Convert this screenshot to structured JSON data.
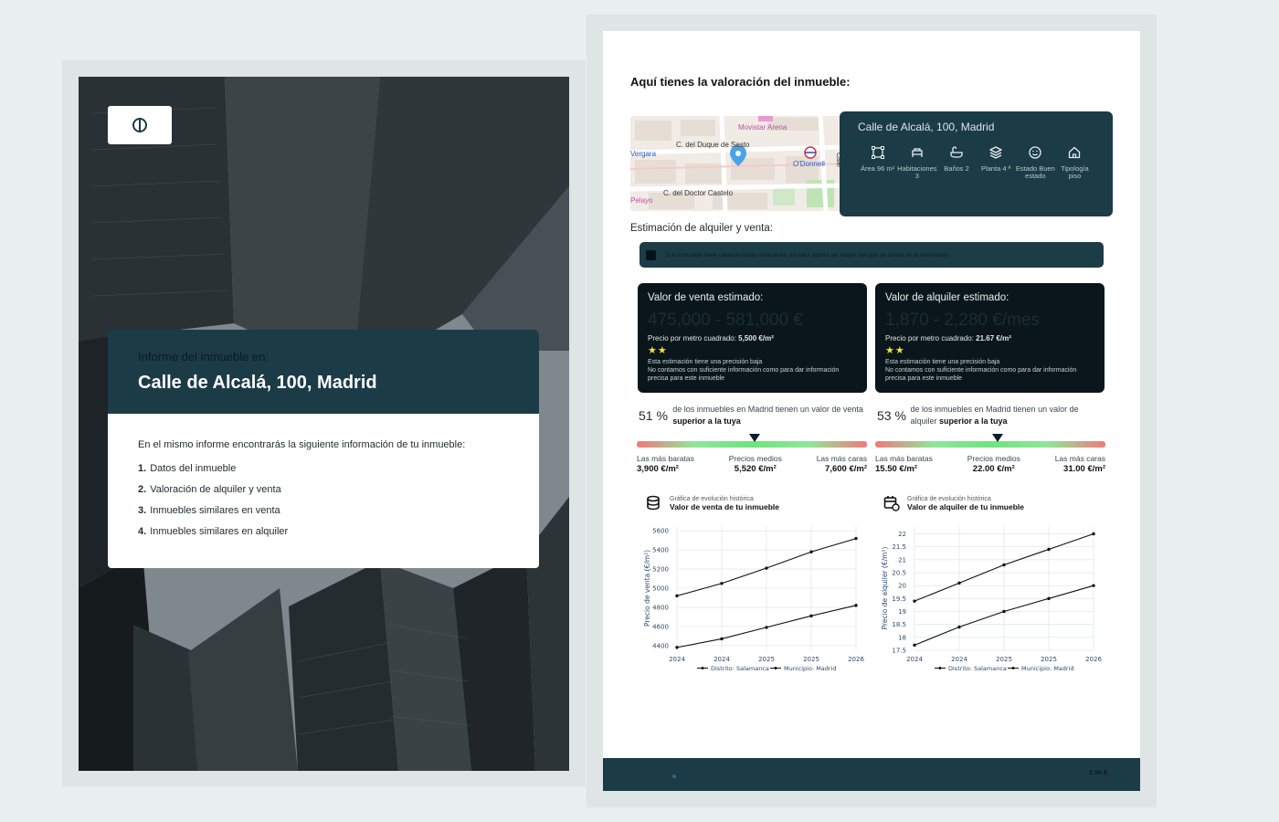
{
  "cover": {
    "subtitle": "Informe del inmueble en:",
    "address": "Calle de Alcalá, 100, Madrid",
    "intro": "En el mismo informe encontrarás la siguiente información de tu inmueble:",
    "items": [
      {
        "num": "1.",
        "label": "Datos del inmueble"
      },
      {
        "num": "2.",
        "label": "Valoración de alquiler y venta"
      },
      {
        "num": "3.",
        "label": "Inmuebles similares en venta"
      },
      {
        "num": "4.",
        "label": "Inmuebles similares en alquiler"
      }
    ]
  },
  "page2": {
    "title": "Aquí tienes la valoración del inmueble:",
    "map_labels": [
      "Movistar Arena",
      "C. del Duque de Sesto",
      "Vergara",
      "O'Donnell",
      "C. del Doctor Castelo",
      "Pelayo",
      "Calle"
    ],
    "property": {
      "address": "Calle de Alcalá, 100, Madrid",
      "features": [
        {
          "icon": "area-icon",
          "label": "Área 96 m²"
        },
        {
          "icon": "bed-icon",
          "label": "Habitaciones 3"
        },
        {
          "icon": "bath-icon",
          "label": "Baños 2"
        },
        {
          "icon": "layers-icon",
          "label": "Planta 4 ª"
        },
        {
          "icon": "smile-icon",
          "label": "Estado Buen estado"
        },
        {
          "icon": "home-icon",
          "label": "Tipología piso"
        }
      ]
    },
    "estimation_title": "Estimación de alquiler y venta:",
    "banner": "Si tu inmueble tiene características exclusivas, su valor podría ser mayor del que se ofrece en la estimación.",
    "sale": {
      "heading": "Valor de venta estimado:",
      "range": "475,000 - 581,000 €",
      "ppm_label": "Precio por metro cuadrado:",
      "ppm_value": "5,500 €/m²",
      "stars": "★★",
      "stars_count": 2,
      "note1": "Esta estimación tiene una precisión baja",
      "note2": "No contamos con suficiente información como para dar información precisa para este inmueble",
      "pct": "51 %",
      "pct_value": 51,
      "desc_pre": "de los inmuebles en Madrid tienen un valor de venta ",
      "desc_bold": "superior a la tuya",
      "low_label": "Las más baratas",
      "low_value": "3,900 €/m²",
      "mid_label": "Precios medios",
      "mid_value": "5,520 €/m²",
      "high_label": "Las más caras",
      "high_value": "7,600 €/m²",
      "chart_kicker": "Gráfica de evolución histórica",
      "chart_title": "Valor de venta de tu inmueble"
    },
    "rent": {
      "heading": "Valor de alquiler estimado:",
      "range": "1,870 - 2,280 €/mes",
      "ppm_label": "Precio por metro cuadrado:",
      "ppm_value": "21.67 €/m²",
      "stars": "★★",
      "stars_count": 2,
      "note1": "Esta estimación tiene una precisión baja",
      "note2": "No contamos con suficiente información como para dar información precisa para este inmueble",
      "pct": "53 %",
      "pct_value": 53,
      "desc_pre": "de los inmuebles en Madrid tienen un valor de alquiler ",
      "desc_bold": "superior a la tuya",
      "low_label": "Las más baratas",
      "low_value": "15.50 €/m²",
      "mid_label": "Precios medios",
      "mid_value": "22.00 €/m²",
      "high_label": "Las más caras",
      "high_value": "31.00 €/m²",
      "chart_kicker": "Gráfica de evolución histórica",
      "chart_title": "Valor de alquiler de tu inmueble"
    },
    "footer_page": "2 de 6"
  },
  "chart_data": [
    {
      "type": "line",
      "title": "",
      "ylabel": "Precio de venta (€/m²)",
      "xlabel": "",
      "x_ticks": [
        "2024",
        "2024",
        "2025",
        "2025",
        "2026"
      ],
      "x": [
        0,
        1,
        2,
        3,
        4
      ],
      "ylim": [
        4350,
        5650
      ],
      "y_ticks": [
        4400,
        4600,
        4800,
        5000,
        5200,
        5400,
        5600
      ],
      "grid": true,
      "legend_position": "bottom",
      "series": [
        {
          "name": "Distrito: Salamanca",
          "values": [
            4920,
            5050,
            5210,
            5380,
            5520
          ]
        },
        {
          "name": "Municipio: Madrid",
          "values": [
            4380,
            4470,
            4590,
            4710,
            4820
          ]
        }
      ]
    },
    {
      "type": "line",
      "title": "",
      "ylabel": "Precio de alquiler (€/m²)",
      "xlabel": "",
      "x_ticks": [
        "2024",
        "2024",
        "2025",
        "2025",
        "2026"
      ],
      "x": [
        0,
        1,
        2,
        3,
        4
      ],
      "ylim": [
        17.5,
        22.3
      ],
      "y_ticks": [
        17.5,
        18,
        18.5,
        19,
        19.5,
        20,
        20.5,
        21,
        21.5,
        22
      ],
      "grid": true,
      "legend_position": "bottom",
      "series": [
        {
          "name": "Distrito: Salamanca",
          "values": [
            19.4,
            20.1,
            20.8,
            21.4,
            22.0
          ]
        },
        {
          "name": "Municipio: Madrid",
          "values": [
            17.7,
            18.4,
            19.0,
            19.5,
            20.0
          ]
        }
      ]
    }
  ]
}
